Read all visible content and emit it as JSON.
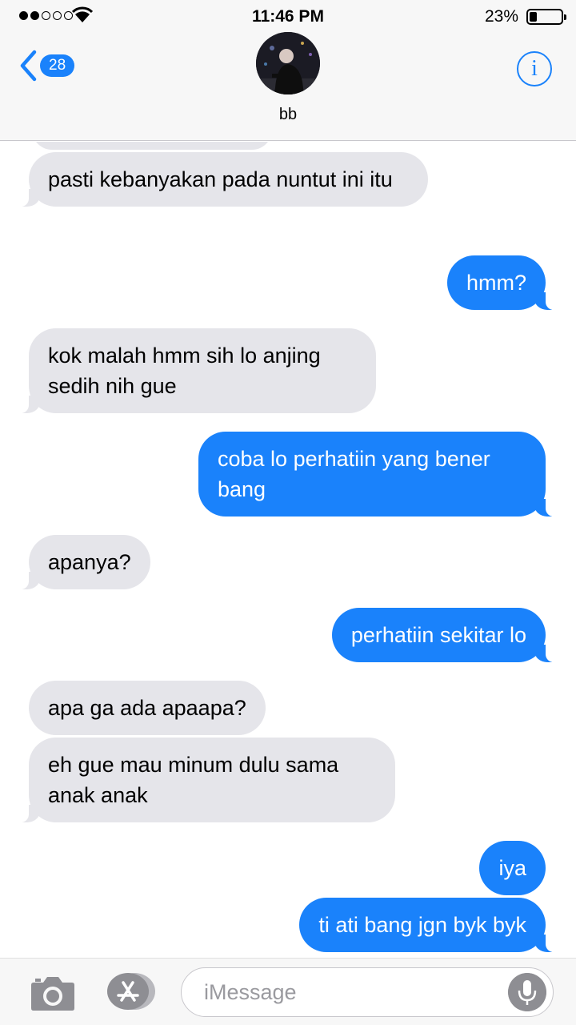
{
  "status": {
    "time": "11:46 PM",
    "battery_percent_label": "23%",
    "battery_level": 0.23,
    "signal_bars_filled": 2,
    "signal_bars_total": 5
  },
  "header": {
    "back_count": "28",
    "contact_name": "bb"
  },
  "messages": [
    {
      "direction": "in",
      "text": "pasti kebanyakan pada nuntut ini itu"
    },
    {
      "direction": "out",
      "text": "hmm?"
    },
    {
      "direction": "in",
      "text": "kok malah hmm sih lo anjing sedih nih gue"
    },
    {
      "direction": "out",
      "text": "coba lo perhatiin yang bener bang"
    },
    {
      "direction": "in",
      "text": "apanya?"
    },
    {
      "direction": "out",
      "text": "perhatiin sekitar lo"
    },
    {
      "direction": "in",
      "text": "apa ga ada apaapa?"
    },
    {
      "direction": "in",
      "text": "eh gue mau minum dulu sama anak anak"
    },
    {
      "direction": "out",
      "text": "iya"
    },
    {
      "direction": "out",
      "text": "ti ati bang jgn byk byk"
    }
  ],
  "composer": {
    "placeholder": "iMessage"
  },
  "colors": {
    "accent": "#1a82fb",
    "incoming_bubble": "#e5e5ea",
    "bar_background": "#f7f7f7"
  },
  "icons": [
    "wifi-icon",
    "back-chevron-icon",
    "info-icon",
    "camera-icon",
    "app-store-icon",
    "microphone-icon"
  ]
}
